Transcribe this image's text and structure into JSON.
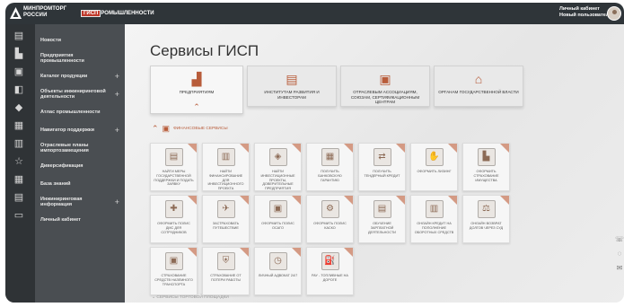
{
  "header": {
    "logo_line1": "МИНПРОМТОРГ",
    "logo_line2": "РОССИИ",
    "gisp_prefix": "ГИСП",
    "gisp_suffix": "РОМЫШЛЕННОСТИ",
    "cabinet_title": "Личный кабинет",
    "cabinet_user": "Новый пользователь"
  },
  "sidebar": {
    "items": [
      {
        "label": "Новости",
        "icon": "news-icon",
        "plus": ""
      },
      {
        "label": "Предприятия промышленности",
        "icon": "factory-icon",
        "plus": ""
      },
      {
        "label": "Каталог продукции",
        "icon": "catalog-icon",
        "plus": "+"
      },
      {
        "label": "Объекты инжиниринговой деятельности",
        "icon": "engineering-icon",
        "plus": "+"
      },
      {
        "label": "Атлас промышленности",
        "icon": "atlas-icon",
        "plus": ""
      },
      {
        "label": "Навигатор поддержки",
        "icon": "navigator-icon",
        "plus": "+"
      },
      {
        "label": "Отраслевые планы импортозамещения",
        "icon": "plans-icon",
        "plus": ""
      },
      {
        "label": "Диверсификация",
        "icon": "star-icon",
        "plus": ""
      },
      {
        "label": "База знаний",
        "icon": "knowledge-icon",
        "plus": ""
      },
      {
        "label": "Инжиниринговая информация",
        "icon": "document-icon",
        "plus": "+"
      },
      {
        "label": "Личный кабинет",
        "icon": "profile-icon",
        "plus": ""
      }
    ]
  },
  "main": {
    "title": "Сервисы ГИСП",
    "categories": [
      {
        "label": "ПРЕДПРИЯТИЯМ",
        "icon": "enterprise-icon"
      },
      {
        "label": "ИНСТИТУТАМ РАЗВИТИЯ И ИНВЕСТОРАМ",
        "icon": "investors-icon"
      },
      {
        "label": "ОТРАСЛЕВЫМ АССОЦИАЦИЯМ, СОЮЗАМ, СЕРТИФИКАЦИОННЫМ ЦЕНТРАМ",
        "icon": "associations-icon"
      },
      {
        "label": "ОРГАНАМ ГОСУДАРСТВЕННОЙ ВЛАСТИ",
        "icon": "government-icon"
      }
    ],
    "section_title": "ФИНАНСОВЫЕ СЕРВИСЫ",
    "footer_section": "СЕРВИСЫ ТОРГОВОЙ ПЛОЩАДКИ",
    "services": [
      {
        "label": "Найти меры государственной поддержки и подать заявку",
        "icon": "support-icon"
      },
      {
        "label": "Найти финансирование для инвестиционного проекта",
        "icon": "finance-icon"
      },
      {
        "label": "Найти инвестиционные проекты, доверительные предприятия",
        "icon": "projects-icon"
      },
      {
        "label": "Получить банковскую гарантию",
        "icon": "guarantee-icon"
      },
      {
        "label": "Получить тендерный кредит",
        "icon": "tender-icon"
      },
      {
        "label": "Оформить лизинг",
        "icon": "leasing-icon"
      },
      {
        "label": "Оформить страхование имущества",
        "icon": "property-icon"
      },
      {
        "label": "Оформить полис ДМС для сотрудников",
        "icon": "medical-icon"
      },
      {
        "label": "Застраховать путешествие",
        "icon": "travel-icon"
      },
      {
        "label": "Оформить полис ОСАГО",
        "icon": "osago-icon"
      },
      {
        "label": "Оформить полис КАСКО",
        "icon": "kasko-icon"
      },
      {
        "label": "Обучение зарплатной деятельности",
        "icon": "training-icon"
      },
      {
        "label": "Онлайн кредит на пополнение оборотных средств",
        "icon": "credit-icon"
      },
      {
        "label": "Онлайн возврат долгов через суд",
        "icon": "court-icon"
      },
      {
        "label": "Страхование средств наземного транспорта",
        "icon": "transport-icon"
      },
      {
        "label": "Страхование от потери работы",
        "icon": "job-icon"
      },
      {
        "label": "Личный адвокат 24/7",
        "icon": "lawyer-icon"
      },
      {
        "label": "Pay - топливные на дороге",
        "icon": "fuel-icon"
      }
    ]
  }
}
